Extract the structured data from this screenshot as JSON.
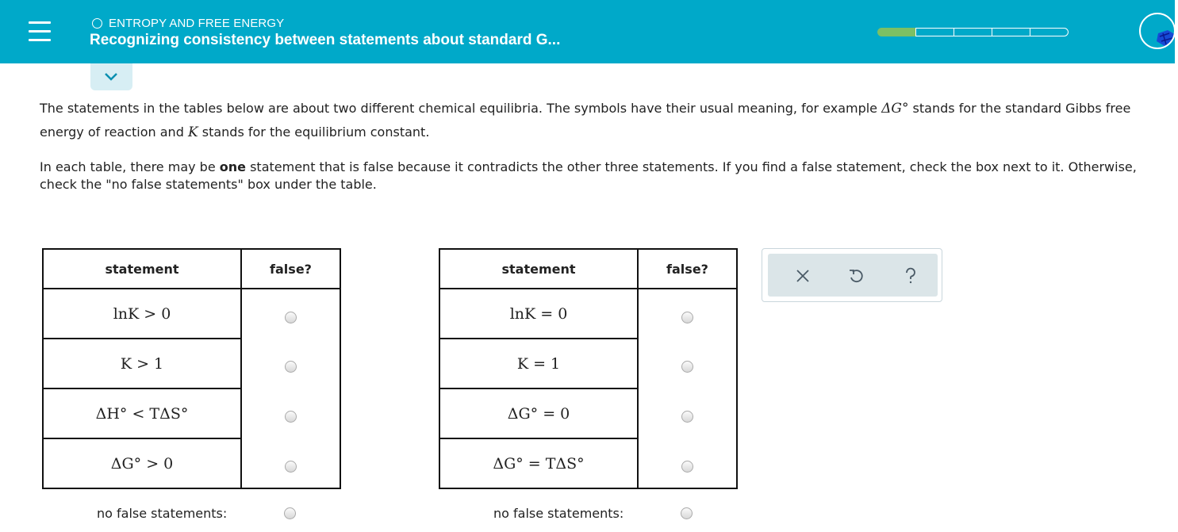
{
  "header": {
    "topic": "ENTROPY AND FREE ENERGY",
    "title": "Recognizing consistency between statements about standard G...",
    "progress": {
      "segments": 5,
      "filled": 1
    },
    "colors": {
      "bar": "#00a9c9",
      "progress_fill": "#7cc064"
    }
  },
  "instructions": {
    "p1_a": "The statements in the tables below are about two different chemical equilibria. The symbols have their usual meaning, for example ",
    "p1_dg": "ΔG°",
    "p1_b": " stands for the standard Gibbs free energy of reaction and ",
    "p1_k": "K",
    "p1_c": " stands for the equilibrium constant.",
    "p2_a": "In each table, there may be ",
    "p2_bold": "one",
    "p2_b": " statement that is false because it contradicts the other three statements. If you find a false statement, check the box next to it. Otherwise, check the \"no false statements\" box under the table."
  },
  "table1": {
    "header_statement": "statement",
    "header_false": "false?",
    "rows": [
      "lnK > 0",
      "K > 1",
      "ΔH° < TΔS°",
      "ΔG° > 0"
    ],
    "no_false_label": "no false statements:"
  },
  "table2": {
    "header_statement": "statement",
    "header_false": "false?",
    "rows": [
      "lnK = 0",
      "K = 1",
      "ΔG° = 0",
      "ΔG° = TΔS°"
    ],
    "no_false_label": "no false statements:"
  },
  "tools": {
    "icons": [
      "close-icon",
      "undo-icon",
      "help-icon"
    ]
  }
}
